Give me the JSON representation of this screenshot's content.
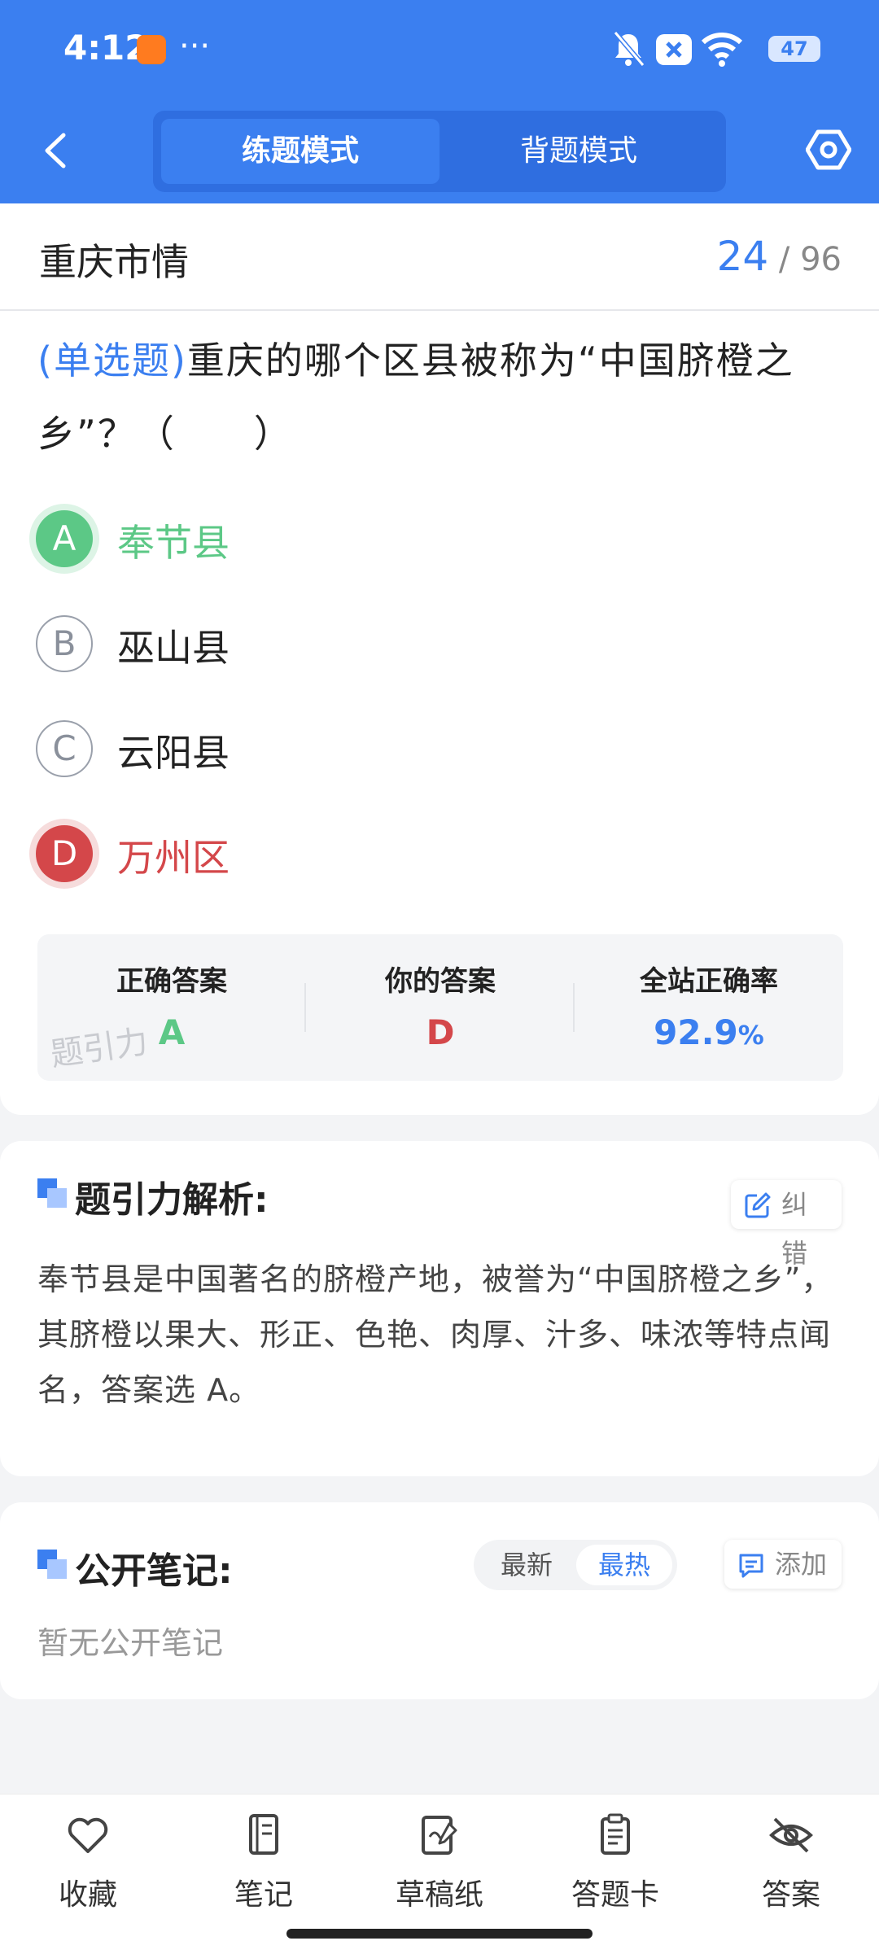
{
  "status_bar": {
    "time": "4:12",
    "more": "···",
    "battery": "47"
  },
  "header": {
    "modes": [
      "练题模式",
      "背题模式"
    ],
    "active_mode": "练题模式"
  },
  "question": {
    "category": "重庆市情",
    "current": "24",
    "total": "/ 96",
    "type": "(单选题)",
    "text": "重庆的哪个区县被称为“中国脐橙之乡”？（　　）",
    "options": [
      {
        "letter": "A",
        "text": "奉节县",
        "state": "correct"
      },
      {
        "letter": "B",
        "text": "巫山县",
        "state": "normal"
      },
      {
        "letter": "C",
        "text": "云阳县",
        "state": "normal"
      },
      {
        "letter": "D",
        "text": "万州区",
        "state": "wrong"
      }
    ]
  },
  "answer_summary": {
    "correct_label": "正确答案",
    "correct_value": "A",
    "yours_label": "你的答案",
    "yours_value": "D",
    "rate_label": "全站正确率",
    "rate_value": "92.9",
    "rate_unit": "%",
    "watermark": "题引力"
  },
  "analysis": {
    "title": "题引力解析:",
    "correct_button": "纠错",
    "text": "奉节县是中国著名的脐橙产地，被誉为“中国脐橙之乡”，其脐橙以果大、形正、色艳、肉厚、汁多、味浓等特点闻名，答案选 A。"
  },
  "notes": {
    "title": "公开笔记:",
    "sort_options": [
      "最新",
      "最热"
    ],
    "active_sort": "最热",
    "add_button": "添加",
    "empty_text": "暂无公开笔记"
  },
  "bottom_tabs": [
    {
      "label": "收藏",
      "icon": "heart-icon"
    },
    {
      "label": "笔记",
      "icon": "notebook-icon"
    },
    {
      "label": "草稿纸",
      "icon": "draft-icon"
    },
    {
      "label": "答题卡",
      "icon": "answer-card-icon"
    },
    {
      "label": "答案",
      "icon": "eye-off-icon"
    }
  ],
  "colors": {
    "primary": "#3b7ff0",
    "correct": "#5cc886",
    "wrong": "#d4474a"
  }
}
